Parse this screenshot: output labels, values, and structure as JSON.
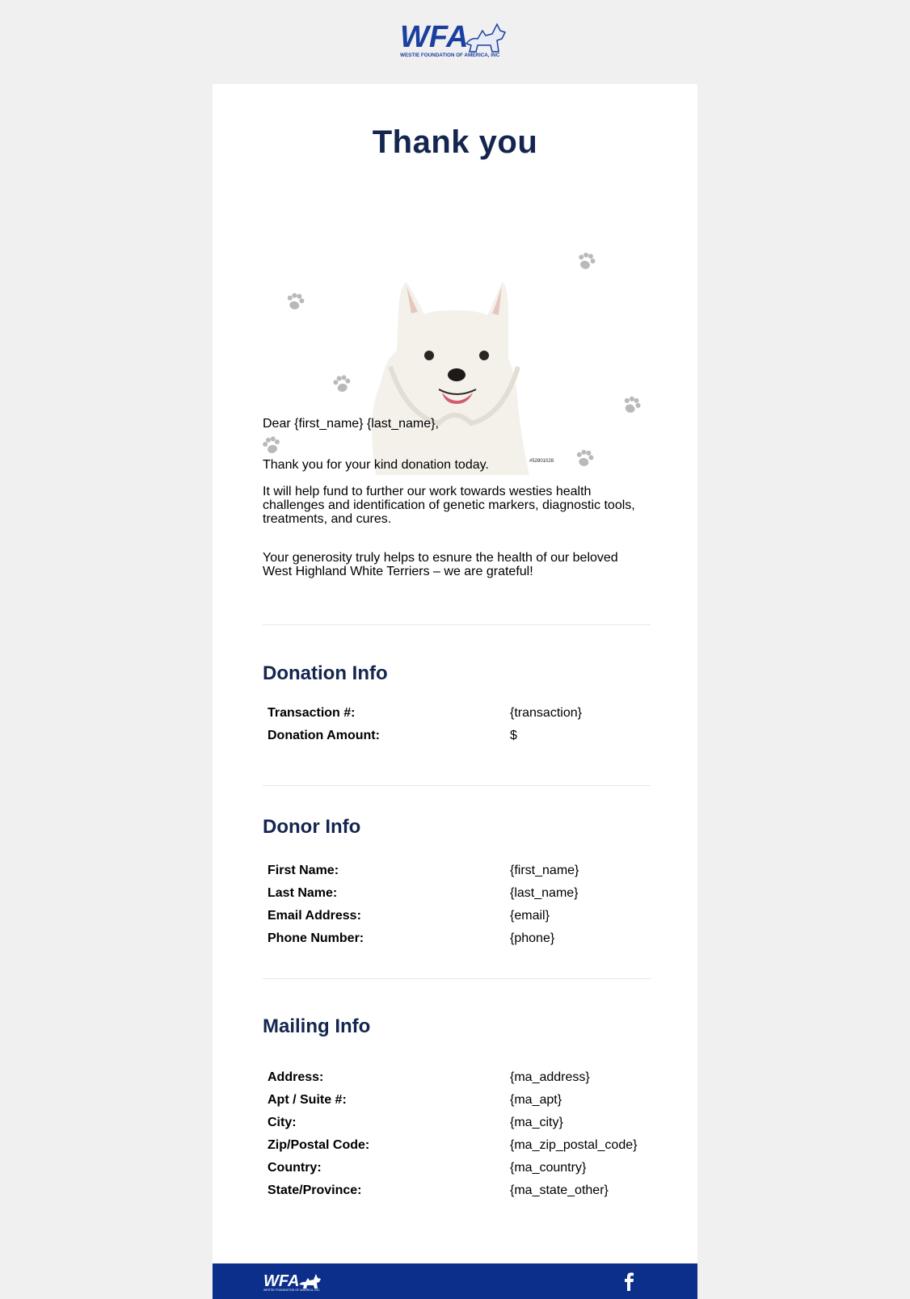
{
  "brand": {
    "logo_text": "WFA",
    "org_name": "WESTIE FOUNDATION OF AMERICA, INC",
    "brand_color": "#14264f",
    "footer_color": "#0b2f8a"
  },
  "title": "Thank you",
  "hero": {
    "image_id_text": "#52801028"
  },
  "message": {
    "greeting": "Dear {first_name} {last_name},",
    "para1": "Thank you for your kind donation today.",
    "para2": "It will help fund to further our work towards westies health challenges and identification of genetic markers, diagnostic tools, treatments, and cures.",
    "para3": "Your generosity truly helps to esnure the health of our beloved West Highland White Terriers – we are grateful!"
  },
  "donation": {
    "heading": "Donation Info",
    "rows": [
      {
        "label": "Transaction #:",
        "value": "{transaction}"
      },
      {
        "label": "Donation Amount:",
        "value": "$"
      }
    ]
  },
  "donor": {
    "heading": "Donor Info",
    "rows": [
      {
        "label": "First Name:",
        "value": "{first_name}"
      },
      {
        "label": "Last Name:",
        "value": "{last_name}"
      },
      {
        "label": "Email Address:",
        "value": "{email}"
      },
      {
        "label": "Phone Number:",
        "value": "{phone}"
      }
    ]
  },
  "mailing": {
    "heading": "Mailing Info",
    "rows": [
      {
        "label": "Address:",
        "value": "{ma_address}"
      },
      {
        "label": "Apt / Suite #:",
        "value": "{ma_apt}"
      },
      {
        "label": "City:",
        "value": "{ma_city}"
      },
      {
        "label": "Zip/Postal Code:",
        "value": "{ma_zip_postal_code}"
      },
      {
        "label": "Country:",
        "value": "{ma_country}"
      },
      {
        "label": "State/Province:",
        "value": "{ma_state_other}"
      }
    ]
  },
  "footer": {
    "social_icon": "facebook-icon"
  }
}
